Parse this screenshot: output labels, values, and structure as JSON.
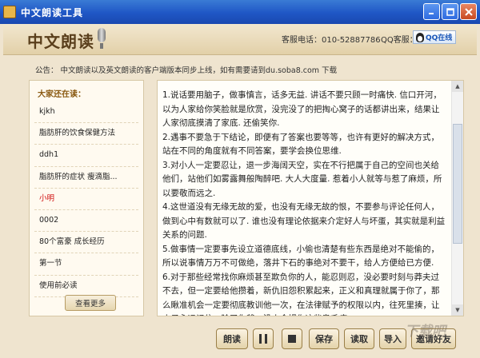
{
  "window": {
    "title": "中文朗读工具"
  },
  "header": {
    "logo": "中文朗读",
    "service_phone": "客服电话：010-52887786",
    "qq_label": "QQ客服：",
    "qq_badge": "QQ在线"
  },
  "notice": "公告：   中文朗读以及英文朗读的客户端版本同步上线，如有需要请到du.soba8.com 下载",
  "sidebar": {
    "title": "大家还在读：",
    "items": [
      "kjkh",
      "脂肪肝的饮食保健方法",
      "ddh1",
      "脂肪肝的症状  瘦滴脂...",
      "小明",
      "0002",
      "80个富豪 成长经历",
      "第一节",
      "使用前必读"
    ],
    "active_index": 4,
    "more_label": "查看更多"
  },
  "content": {
    "paragraphs": [
      "1.说话要用脑子，做事慎言，话多无益. 讲话不要只顾一时痛快. 信口开河，以为人家给你笑脸就是欣赏，没完没了的把掏心窝子的话都讲出来，结果让人家彻底摸清了家底. 还偷笑你.",
      "2.遇事不要急于下结论，即便有了答案也要等等，也许有更好的解决方式，站在不同的角度就有不同答案，要学会换位思维.",
      "3.对小人一定要忍让，退一步海阔天空，实在不行把属于自己的空间也关给他们，站他们如雾露舞般陶醉吧. 大人大度量. 惹着小人就等与惹了麻烦，所以要敬而远之.",
      "4.这世道没有无缘无故的爱，也没有无缘无故的恨，不要参与评论任何人，做到心中有数就可以了. 谁也没有理论依据来介定好人与坏蛋，其实就是利益关系的问题.",
      "5.做事情一定要事先设立道德底线，小偷也清楚有些东西是绝对不能偷的，所以说事情万万不可做绝，落井下石的事绝对不要干，给人方便给已方便.",
      "6.对于那些经常找你麻烦甚至欺负你的人，能忍则忍，没必要时刻与莽夫过不去，但一定要给他攒着，新仇旧怨积累起来，正义和真理就属于你了，那么瞅准机会一定要彻底教训他一次，在法律赋予的权限以内，往死里揍，让小子永远记住：除了你爹，没人会惯你这些臭毛病."
    ]
  },
  "toolbar": {
    "read": "朗读",
    "save": "保存",
    "load": "读取",
    "import": "导入",
    "invite": "邀请好友"
  },
  "watermark": "下载吧"
}
